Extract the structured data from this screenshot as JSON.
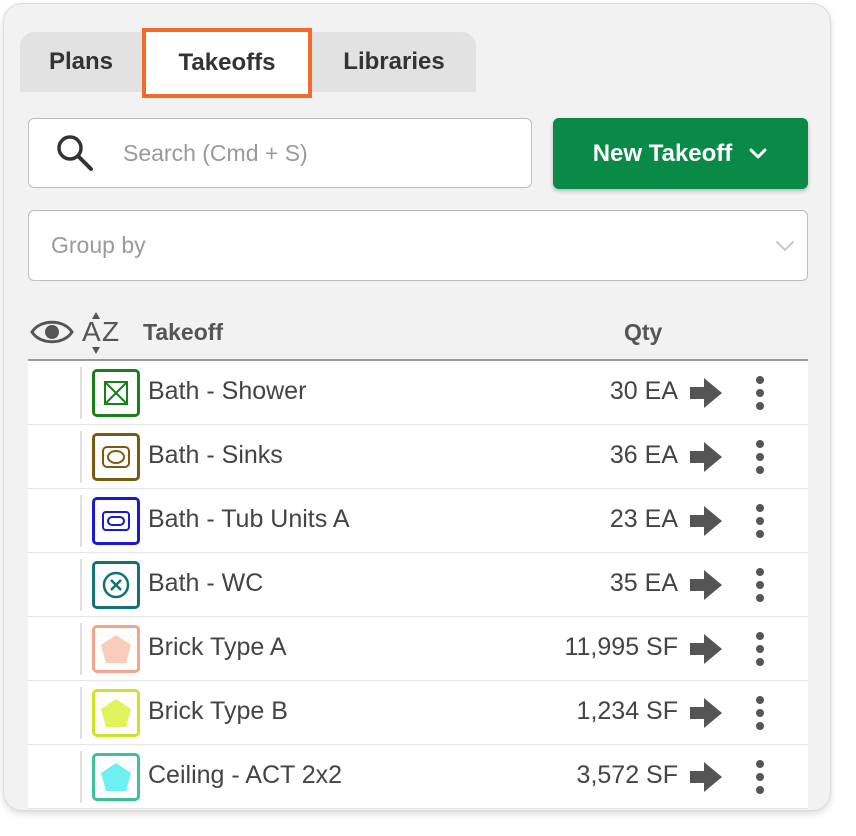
{
  "tabs": {
    "plans": "Plans",
    "takeoffs": "Takeoffs",
    "libraries": "Libraries"
  },
  "search": {
    "placeholder": "Search (Cmd + S)",
    "value": ""
  },
  "new_takeoff": {
    "label": "New Takeoff"
  },
  "group_by": {
    "placeholder": "Group by"
  },
  "columns": {
    "takeoff": "Takeoff",
    "qty": "Qty"
  },
  "colors": {
    "accent_tab_outline": "#f26a2e",
    "primary_button": "#0a8a47"
  },
  "rows": [
    {
      "name": "Bath - Shower",
      "qty": "30 EA",
      "color": "#1a7f1a",
      "icon": "square-cross-icon"
    },
    {
      "name": "Bath - Sinks",
      "qty": "36 EA",
      "color": "#7a5a12",
      "icon": "sink-icon"
    },
    {
      "name": "Bath - Tub Units A",
      "qty": "23 EA",
      "color": "#1a1ad6",
      "icon": "tub-icon"
    },
    {
      "name": "Bath - WC",
      "qty": "35 EA",
      "color": "#117373",
      "icon": "circle-x-icon"
    },
    {
      "name": "Brick Type A",
      "qty": "11,995 SF",
      "color": "#f0a58c",
      "fill": "#f9cbbb",
      "icon": "pentagon-icon"
    },
    {
      "name": "Brick Type B",
      "qty": "1,234 SF",
      "color": "#cde32a",
      "fill": "#e2f35a",
      "icon": "pentagon-icon"
    },
    {
      "name": "Ceiling - ACT 2x2",
      "qty": "3,572 SF",
      "color": "#3dbf9a",
      "fill": "#6cf0f2",
      "icon": "pentagon-icon"
    }
  ]
}
